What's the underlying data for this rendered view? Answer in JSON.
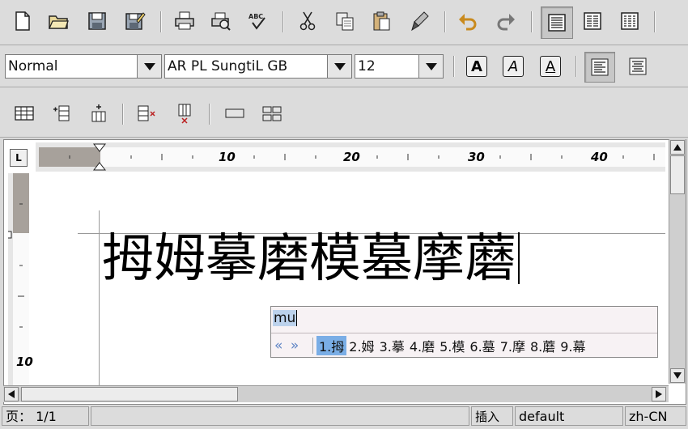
{
  "toolbar_standard": {
    "icons": [
      "new-document-icon",
      "open-folder-icon",
      "save-icon",
      "save-as-icon",
      "print-icon",
      "print-preview-icon",
      "spellcheck-icon",
      "cut-icon",
      "copy-icon",
      "paste-icon",
      "format-paint-icon",
      "undo-icon",
      "redo-icon",
      "align-normal-view-icon",
      "columns-view-icon",
      "table-view-icon"
    ],
    "spellcheck_label": "ABC"
  },
  "toolbar_format": {
    "style": "Normal",
    "font": "AR PL SungtiL GB",
    "size": "12",
    "bold_label": "A",
    "italic_label": "A",
    "underline_label": "A"
  },
  "ruler": {
    "corner_label": "L",
    "h_numbers": [
      "10",
      "20",
      "30",
      "40"
    ],
    "v_numbers": [
      "10"
    ]
  },
  "document": {
    "text": "拇姆摹磨模墓摩蘑"
  },
  "ime": {
    "preedit": "mu",
    "prev": "«",
    "next": "»",
    "candidates": [
      "1.拇",
      "2.姆",
      "3.摹",
      "4.磨",
      "5.模",
      "6.墓",
      "7.摩",
      "8.蘑",
      "9.幕"
    ],
    "selected_index": 0
  },
  "status": {
    "page": "页： 1/1",
    "mode": "插入",
    "page_style": "default",
    "language": "zh-CN"
  },
  "colors": {
    "ime_highlight": "#7aaee6",
    "ime_nav": "#5c83c4"
  }
}
